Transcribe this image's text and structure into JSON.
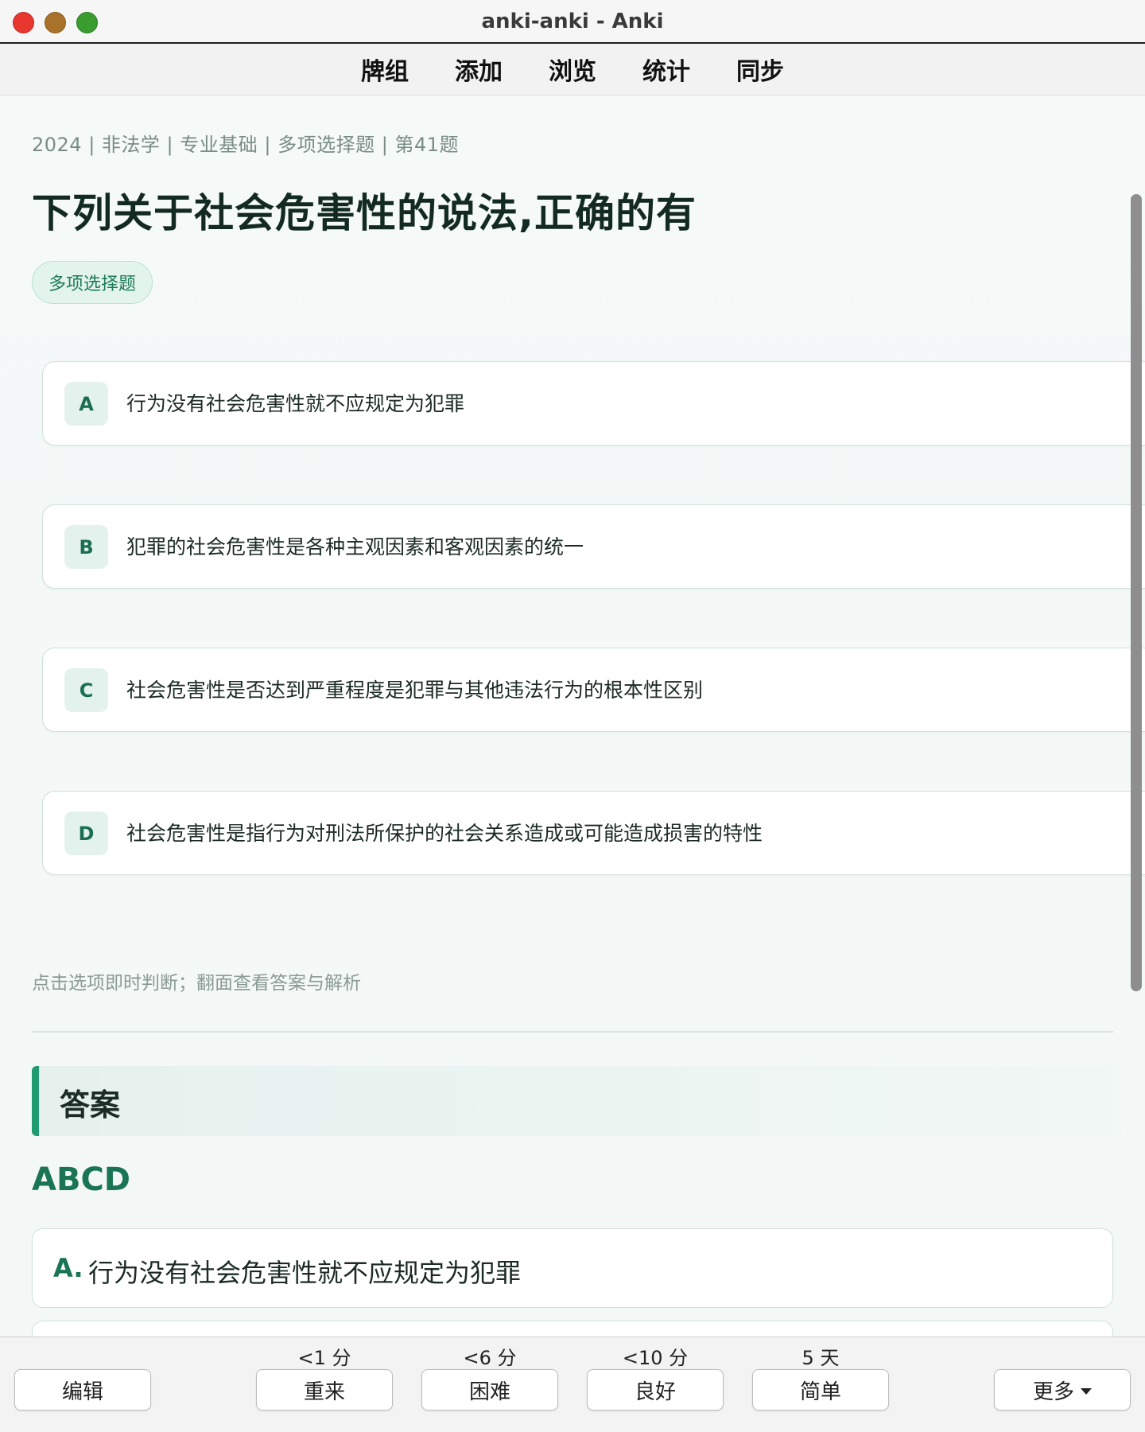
{
  "window": {
    "title": "anki-anki - Anki"
  },
  "nav": [
    "牌组",
    "添加",
    "浏览",
    "统计",
    "同步"
  ],
  "card": {
    "meta": "2024 | 非法学 | 专业基础 | 多项选择题 | 第41题",
    "question": "下列关于社会危害性的说法,正确的有",
    "type_badge": "多项选择题",
    "options": [
      {
        "letter": "A",
        "text": "行为没有社会危害性就不应规定为犯罪"
      },
      {
        "letter": "B",
        "text": "犯罪的社会危害性是各种主观因素和客观因素的统一"
      },
      {
        "letter": "C",
        "text": "社会危害性是否达到严重程度是犯罪与其他违法行为的根本性区别"
      },
      {
        "letter": "D",
        "text": "社会危害性是指行为对刑法所保护的社会关系造成或可能造成损害的特性"
      }
    ],
    "hint": "点击选项即时判断；翻面查看答案与解析",
    "answer_heading": "答案",
    "answer_value": "ABCD",
    "answer_items": [
      {
        "label": "A.",
        "text": "行为没有社会危害性就不应规定为犯罪"
      }
    ]
  },
  "bottom": {
    "edit_label": "编辑",
    "more_label": "更多",
    "ease_buttons": [
      {
        "label": "重来",
        "interval": "<1 分"
      },
      {
        "label": "困难",
        "interval": "<6 分"
      },
      {
        "label": "良好",
        "interval": "<10 分"
      },
      {
        "label": "简单",
        "interval": "5 天"
      }
    ]
  }
}
